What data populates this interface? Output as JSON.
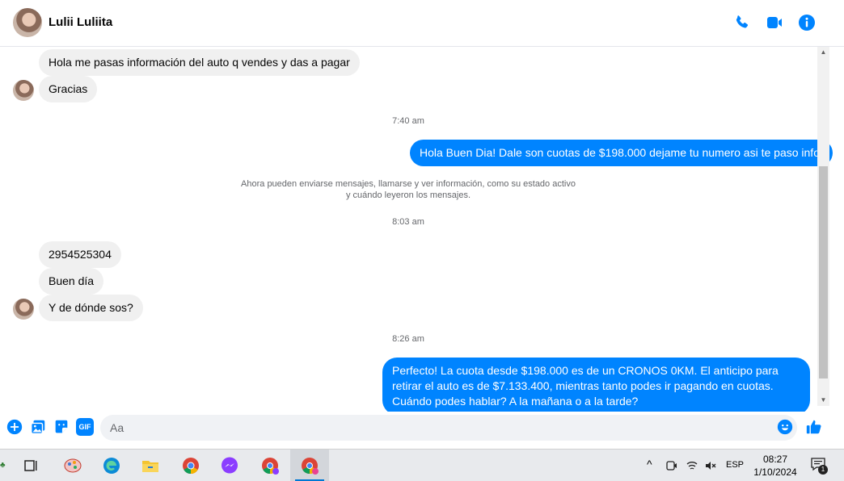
{
  "header": {
    "contact_name": "Lulii Luliita",
    "icons": [
      "phone-icon",
      "video-camera-icon",
      "info-icon"
    ],
    "accent_color": "#0084ff"
  },
  "messages": [
    {
      "side": "in",
      "text": "Hola me pasas información del auto q vendes y das a pagar"
    },
    {
      "side": "in",
      "text": "Gracias"
    },
    {
      "type": "time",
      "text": "7:40 am"
    },
    {
      "side": "out",
      "text": "Hola Buen Dia! Dale son cuotas de $198.000 dejame tu numero asi te paso info."
    },
    {
      "type": "notice",
      "line1": "Ahora pueden enviarse mensajes, llamarse y ver información, como su estado activo",
      "line2": "y cuándo leyeron los mensajes."
    },
    {
      "type": "time",
      "text": "8:03 am"
    },
    {
      "side": "in",
      "text": "2954525304"
    },
    {
      "side": "in",
      "text": "Buen día"
    },
    {
      "side": "in",
      "text": "Y de dónde sos?"
    },
    {
      "type": "time",
      "text": "8:26 am"
    },
    {
      "side": "out",
      "text": "Perfecto! La cuota desde $198.000 es de un CRONOS 0KM. El anticipo para retirar el auto es de $7.133.400, mientras tanto podes ir pagando en cuotas. Cuándo podes hablar? A la mañana o a la tarde?"
    }
  ],
  "composer": {
    "placeholder": "Aa",
    "icons": [
      "plus-icon",
      "photo-icon",
      "sticker-icon",
      "gif-icon",
      "emoji-icon",
      "like-icon"
    ],
    "gif_label": "GIF"
  },
  "taskbar": {
    "apps": [
      "task-view-icon",
      "paint-icon",
      "edge-icon",
      "file-explorer-icon",
      "chrome-icon",
      "messenger-icon",
      "chrome-profile-icon",
      "chrome-active-icon"
    ],
    "language": "ESP",
    "time": "08:27",
    "date": "1/10/2024",
    "notification_count": "1"
  }
}
